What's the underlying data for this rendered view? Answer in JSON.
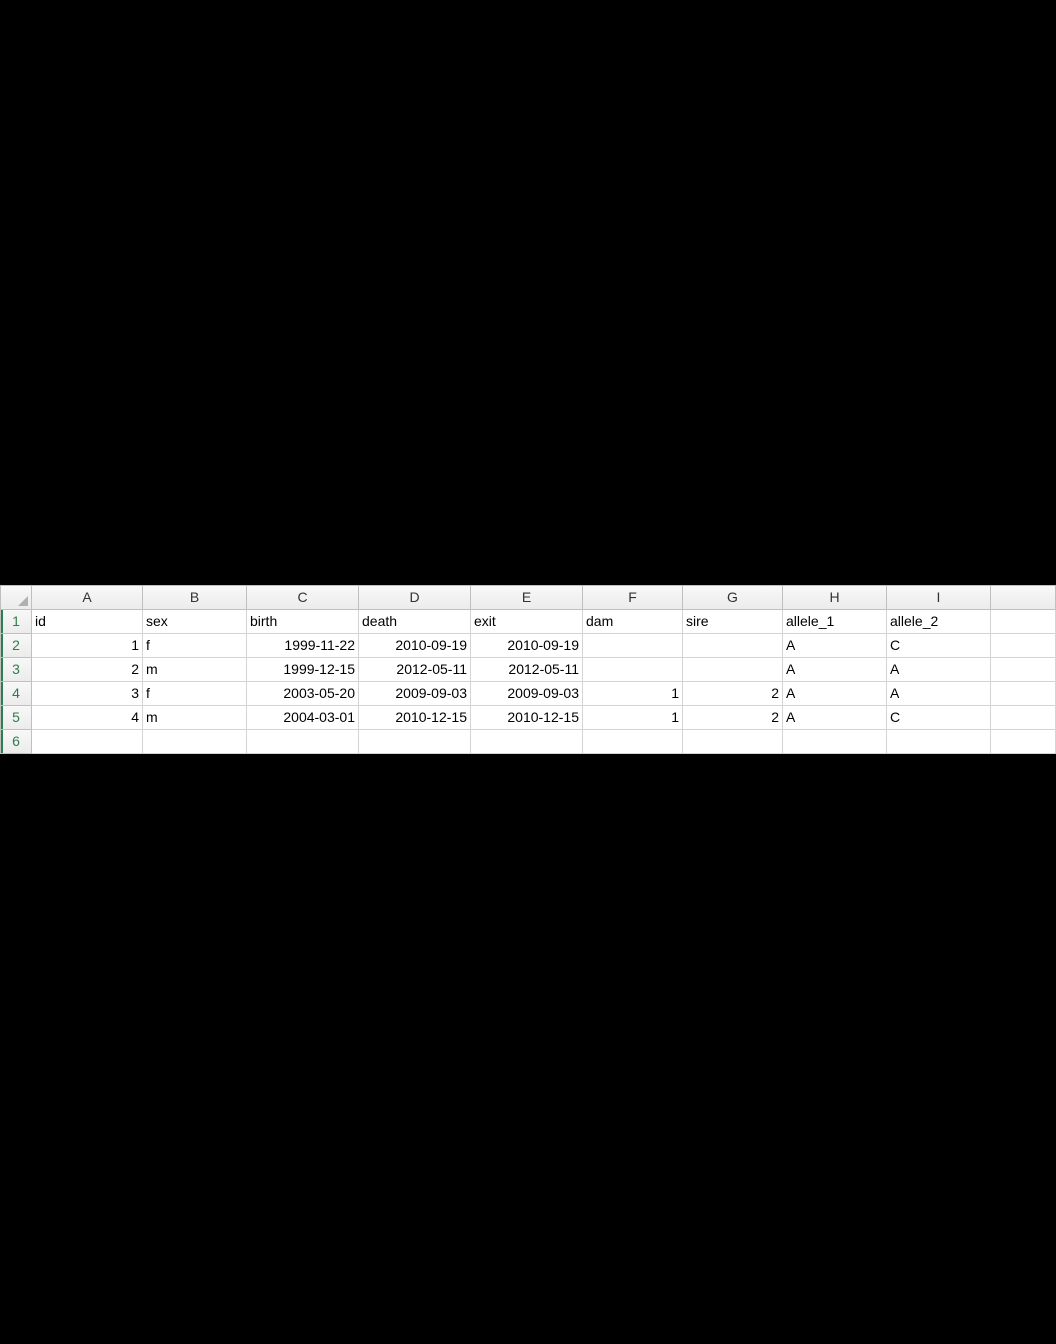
{
  "columns": [
    "A",
    "B",
    "C",
    "D",
    "E",
    "F",
    "G",
    "H",
    "I",
    ""
  ],
  "rowNumbers": [
    "1",
    "2",
    "3",
    "4",
    "5",
    "6"
  ],
  "headers": {
    "A": "id",
    "B": "sex",
    "C": "birth",
    "D": "death",
    "E": "exit",
    "F": "dam",
    "G": "sire",
    "H": "allele_1",
    "I": "allele_2"
  },
  "rows": [
    {
      "id": "1",
      "sex": "f",
      "birth": "1999-11-22",
      "death": "2010-09-19",
      "exit": "2010-09-19",
      "dam": "",
      "sire": "",
      "allele_1": "A",
      "allele_2": "C"
    },
    {
      "id": "2",
      "sex": "m",
      "birth": "1999-12-15",
      "death": "2012-05-11",
      "exit": "2012-05-11",
      "dam": "",
      "sire": "",
      "allele_1": "A",
      "allele_2": "A"
    },
    {
      "id": "3",
      "sex": "f",
      "birth": "2003-05-20",
      "death": "2009-09-03",
      "exit": "2009-09-03",
      "dam": "1",
      "sire": "2",
      "allele_1": "A",
      "allele_2": "A"
    },
    {
      "id": "4",
      "sex": "m",
      "birth": "2004-03-01",
      "death": "2010-12-15",
      "exit": "2010-12-15",
      "dam": "1",
      "sire": "2",
      "allele_1": "A",
      "allele_2": "C"
    }
  ]
}
